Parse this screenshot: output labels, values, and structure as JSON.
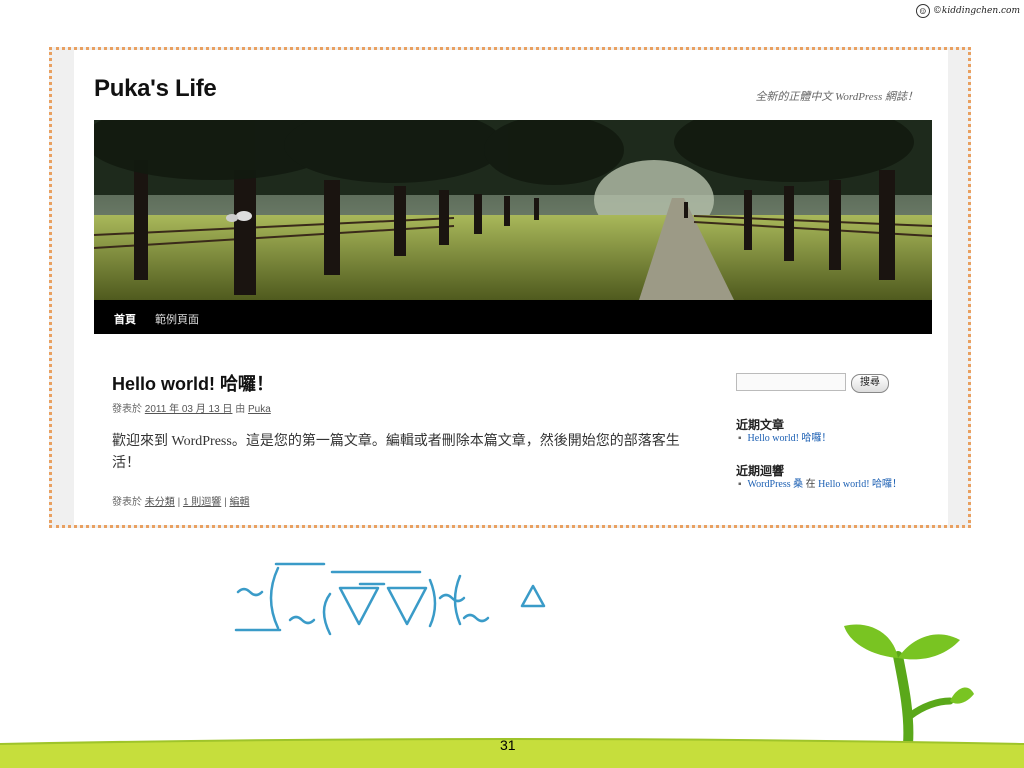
{
  "site_mark": {
    "text": "©kiddingchen.com",
    "icon": "smiley-icon"
  },
  "screenshot": {
    "site_title": "Puka's Life",
    "site_description": "全新的正體中文 WordPress 網誌！",
    "header_image": "tree-lined-path-photo",
    "nav": {
      "home": "首頁",
      "sample_page": "範例頁面"
    },
    "post": {
      "title": "Hello world! 哈囉！",
      "meta_prefix": "發表於",
      "meta_date": "2011 年 03 月 13 日",
      "meta_by": "由",
      "meta_author": "Puka",
      "body": "歡迎來到 WordPress。這是您的第一篇文章。編輯或者刪除本篇文章，然後開始您的部落客生活！",
      "footer_prefix": "發表於",
      "footer_category": "未分類",
      "footer_sep1": "|",
      "footer_comments": "1 則迴響",
      "footer_sep2": "|",
      "footer_edit": "編輯"
    },
    "sidebar": {
      "search_button": "搜尋",
      "recent_posts_title": "近期文章",
      "recent_posts": [
        "Hello world! 哈囉！"
      ],
      "recent_comments_title": "近期迴響",
      "recent_comment": {
        "author": "WordPress 桑",
        "in": "在",
        "post": "Hello world! 哈囉！"
      }
    }
  },
  "page_number": "31",
  "colors": {
    "frame_border": "#e9a060",
    "link": "#1b5fb3",
    "emoticon": "#3a9bc8",
    "ground": "#c6de3c",
    "sprout": "#79c422"
  }
}
